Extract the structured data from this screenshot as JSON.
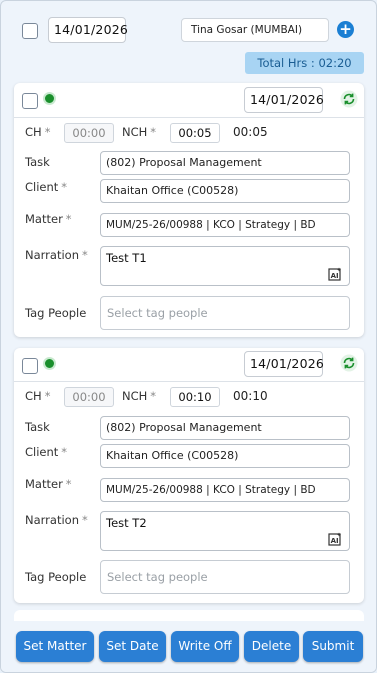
{
  "header": {
    "date": "14/01/2026",
    "user": "Tina Gosar (MUMBAI)",
    "total_label": "Total Hrs : 02:20"
  },
  "entries": [
    {
      "date": "14/01/2026",
      "ch_label": "CH",
      "ch_value": "00:00",
      "nch_label": "NCH",
      "nch_value": "00:05",
      "total": "00:05",
      "task_label": "Task",
      "task": "(802) Proposal Management",
      "client_label": "Client",
      "client": "Khaitan Office (C00528)",
      "matter_label": "Matter",
      "matter": "MUM/25-26/00988 | KCO | Strategy | BD",
      "narration_label": "Narration",
      "narration": "Test T1",
      "tag_label": "Tag People",
      "tag_placeholder": "Select tag people"
    },
    {
      "date": "14/01/2026",
      "ch_label": "CH",
      "ch_value": "00:00",
      "nch_label": "NCH",
      "nch_value": "00:10",
      "total": "00:10",
      "task_label": "Task",
      "task": "(802) Proposal Management",
      "client_label": "Client",
      "client": "Khaitan Office (C00528)",
      "matter_label": "Matter",
      "matter": "MUM/25-26/00988 | KCO | Strategy | BD",
      "narration_label": "Narration",
      "narration": "Test T2",
      "tag_label": "Tag People",
      "tag_placeholder": "Select tag people"
    }
  ],
  "required_mark": "*",
  "footer": {
    "set_matter": "Set Matter",
    "set_date": "Set Date",
    "write_off": "Write Off",
    "delete": "Delete",
    "submit": "Submit"
  },
  "colors": {
    "primary": "#2b7fd4",
    "status_green": "#1a8f2c",
    "total_bg": "#a8d4f3"
  },
  "icons": {
    "add": "plus-circle-icon",
    "sync": "sync-icon",
    "ai": "ai-assist-icon"
  }
}
